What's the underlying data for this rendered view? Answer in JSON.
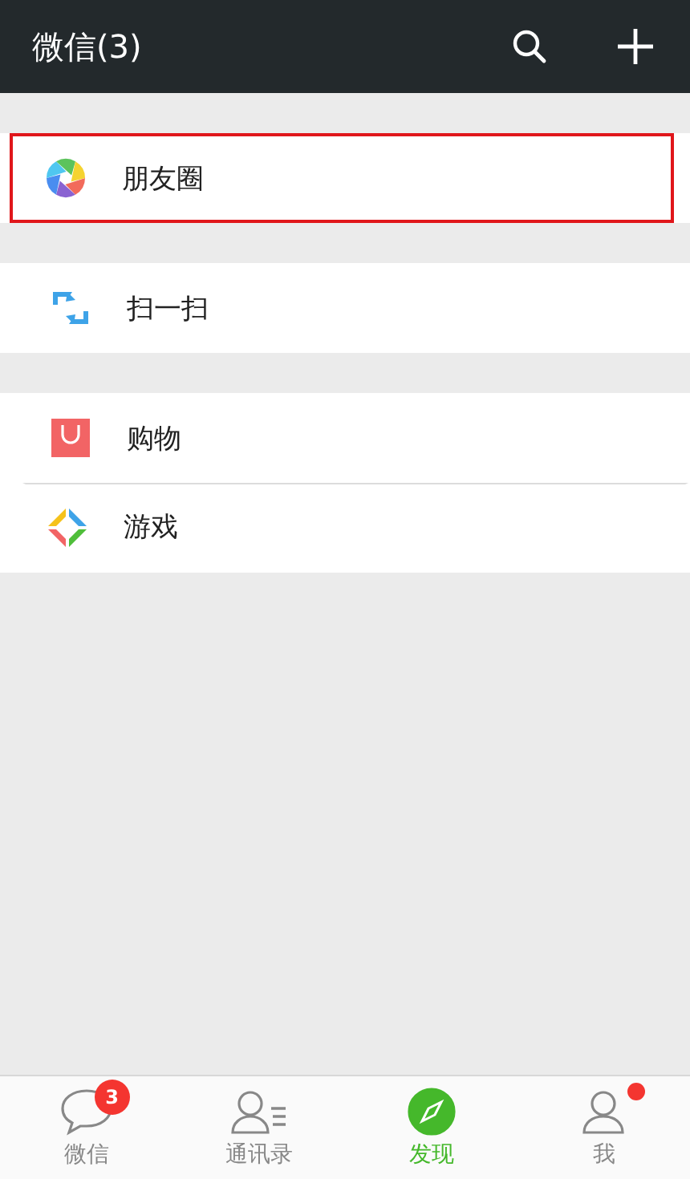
{
  "header": {
    "title": "微信(3)"
  },
  "groups": [
    {
      "items": [
        {
          "label": "朋友圈",
          "kind": "aperture",
          "highlighted": true
        }
      ]
    },
    {
      "items": [
        {
          "label": "扫一扫",
          "kind": "scan",
          "highlighted": false
        }
      ]
    },
    {
      "items": [
        {
          "label": "购物",
          "kind": "bag",
          "highlighted": false
        },
        {
          "label": "游戏",
          "kind": "game",
          "highlighted": false
        }
      ]
    }
  ],
  "tabs": [
    {
      "label": "微信",
      "kind": "chat",
      "selected": false,
      "badge": "3",
      "dot": false
    },
    {
      "label": "通讯录",
      "kind": "contacts",
      "selected": false,
      "dot": false
    },
    {
      "label": "发现",
      "kind": "compass",
      "selected": true,
      "dot": false
    },
    {
      "label": "我",
      "kind": "person",
      "selected": false,
      "dot": true
    }
  ]
}
